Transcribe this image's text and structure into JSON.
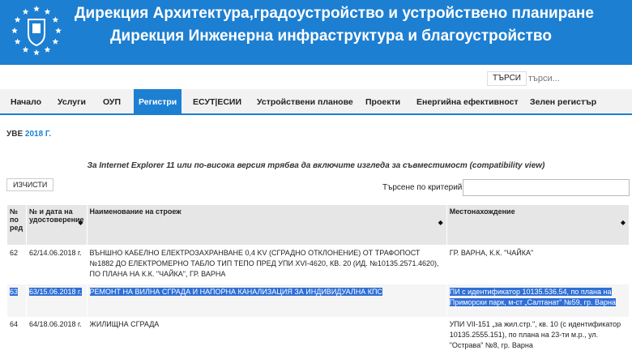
{
  "header": {
    "line1": "Дирекция Архитектура,градоустройство и устройствено планиране",
    "line2": "Дирекция Инженерна инфраструктура и благоустройство"
  },
  "search": {
    "button_label": "ТЪРСИ",
    "placeholder": "търси..."
  },
  "nav": {
    "items": [
      "Начало",
      "Услуги",
      "ОУП",
      "Регистри",
      "ЕСУТ|ЕСИИ",
      "Устройствени планове",
      "Проекти",
      "Енергийна ефективност",
      "Зелен регистър"
    ],
    "active": "Регистри"
  },
  "breadcrumb": {
    "prefix": "УВЕ",
    "year": "2018 Г."
  },
  "compat_note": "За Internet Explorer 11 или по-висока версия трябва да включите изгледа за съвместимост (compatibility view)",
  "toolbar": {
    "clear_label": "ИЗЧИСТИ",
    "filter_label": "Търсене по критерий"
  },
  "table": {
    "headers": {
      "no": "№ по ред",
      "num": "№ и дата на удостоверение",
      "name": "Наименование на строеж",
      "loc": "Местонахождение"
    },
    "rows": [
      {
        "no": "62",
        "num": "62/14.06.2018 г.",
        "name": "ВЪНШНО КАБЕЛНО ЕЛЕКТРОЗАХРАНВАНЕ 0,4 KV (СГРАДНО ОТКЛОНЕНИЕ) ОТ ТРАФОПОСТ №1882 ДО ЕЛЕКТРОМЕРНО ТАБЛО ТИП ТЕПО ПРЕД УПИ XVI-4620, КВ. 20 (ИД. №10135.2571.4620), ПО ПЛАНА НА К.К. \"ЧАЙКА\", ГР. ВАРНА",
        "loc": "ГР. ВАРНА, К.К. \"ЧАЙКА\""
      },
      {
        "no": "63",
        "num": "63/15.06.2018 г.",
        "name": "РЕМОНТ НА ВИЛНА СГРАДА И НАПОРНА КАНАЛИЗАЦИЯ ЗА ИНДИВИДУАЛНА КПС",
        "loc": "ПИ с идентификатор 10135.536.54, по плана на Приморски парк, м-ст „Салтанат\" №59, гр. Варна"
      },
      {
        "no": "64",
        "num": "64/18.06.2018 г.",
        "name": "ЖИЛИЩНА СГРАДА",
        "loc": "УПИ VII-151 „за жил.стр.\", кв. 10 (с идентификатор 10135.2555.151), по плана на 23-ти м.р., ул. \"Острава\" №8, гр. Варна"
      }
    ]
  },
  "colors": {
    "brand_blue": "#1d7fd1",
    "selection": "#2f6fd6"
  }
}
